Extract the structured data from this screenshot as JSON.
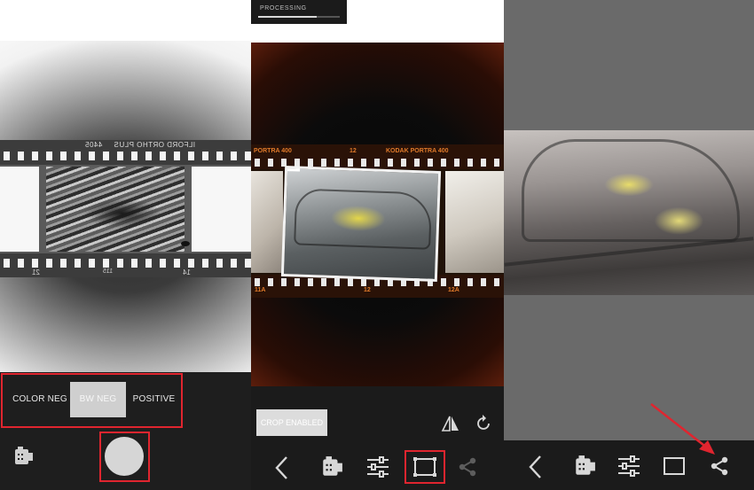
{
  "panels": {
    "bw": {
      "film_text_top": "ILFORD ORTHO PLUS",
      "film_code_top": "4405",
      "film_frame_bottom": "21",
      "film_code_bottom": "115",
      "film_frame_bottom_right": "14",
      "modes": {
        "color_neg": "COLOR NEG",
        "bw_neg": "BW NEG",
        "positive": "POSITIVE"
      },
      "film_icon": "film-canister-icon",
      "capture_icon": "shutter-button"
    },
    "processing": {
      "status_label": "PROCESSING",
      "progress": 0.72,
      "film_text_left": "PORTRA 400",
      "film_frame_number": "12",
      "film_text_right": "KODAK PORTRA 400",
      "frame_label_bottom_left": "11A",
      "frame_label_bottom_center": "12",
      "frame_label_bottom_right": "12A",
      "crop_button": "CROP ENABLED",
      "icons": {
        "flip": "flip-icon",
        "rotate": "rotate-icon",
        "back": "chevron-left-icon",
        "film": "film-canister-icon",
        "adjust": "sliders-icon",
        "crop": "crop-icon",
        "share": "share-icon"
      }
    },
    "result": {
      "icons": {
        "back": "chevron-left-icon",
        "film": "film-canister-icon",
        "adjust": "sliders-icon",
        "crop": "crop-icon",
        "share": "share-icon"
      }
    }
  },
  "colors": {
    "annotation_red": "#e0252f",
    "toolbar_bg": "#1b1b1b",
    "film_orange": "#e07a2a"
  }
}
